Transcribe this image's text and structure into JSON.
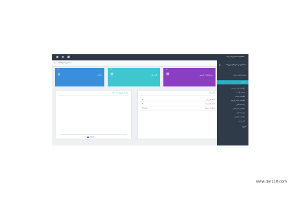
{
  "topbar": {
    "brand": "مجموعه مدیریت وب",
    "icons": [
      "user-icon",
      "bell-icon",
      "settings-icon"
    ]
  },
  "toolbar": {
    "crumb": "مدیریت وبسایت >"
  },
  "sidebar": {
    "search_text": "جستجو در منو ها و ابزارها",
    "items": [
      {
        "label": "صفحه اصلی سایت"
      },
      {
        "label": "مدیریت"
      }
    ],
    "sub_items": [
      {
        "label": "تنظیمات پنل مدیریت"
      },
      {
        "label": "تعریف کاربر"
      },
      {
        "label": "تنظیمات سایت"
      },
      {
        "label": "تنظیمات بخش فروش"
      },
      {
        "label": "پرداخت آنلاین"
      },
      {
        "label": "سیستم پیام رسانی"
      },
      {
        "label": "مدیریت فایل"
      },
      {
        "label": "تنظیمات ظاهری"
      },
      {
        "label": "آمار بازدید"
      }
    ],
    "footer_label": "خروج"
  },
  "tiles": [
    {
      "label": "سفارشات امروز",
      "color": "#8a3fc3",
      "value": "0"
    },
    {
      "label": "کاربران",
      "color": "#3fc7cf",
      "value": "0"
    },
    {
      "label": "بازدید",
      "color": "#3a8fdc",
      "value": "0"
    }
  ],
  "panels": {
    "right": {
      "title": "آمار پایه",
      "rows": [
        {
          "label": "تعداد کاربران",
          "value": "0"
        },
        {
          "label": "تعداد سفارشات",
          "value": "0"
        },
        {
          "label": "مبلغ کل فروش",
          "value": "0 تومان"
        }
      ]
    },
    "left": {
      "title": "نمودار فروش یک هفته",
      "legend": "فروش"
    }
  },
  "watermark": "www.dar118.com"
}
